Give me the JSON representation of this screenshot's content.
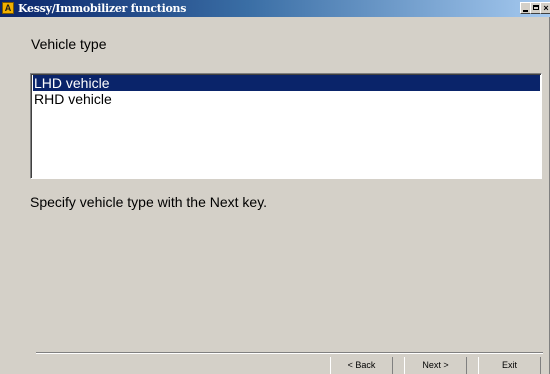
{
  "window": {
    "title": "Kessy/Immobilizer functions",
    "icon_letter": "A",
    "controls": {
      "minimize": "minimize-icon",
      "maximize": "maximize-icon",
      "close": "×"
    }
  },
  "main": {
    "section_label": "Vehicle type",
    "list": {
      "items": [
        {
          "label": "LHD vehicle",
          "selected": true
        },
        {
          "label": "RHD vehicle",
          "selected": false
        }
      ]
    },
    "hint": "Specify vehicle type with the Next key."
  },
  "footer": {
    "back_label": "< Back",
    "next_label": "Next >",
    "exit_label": "Exit"
  },
  "colors": {
    "selection": "#0a246a",
    "window_bg": "#d4d0c8"
  }
}
